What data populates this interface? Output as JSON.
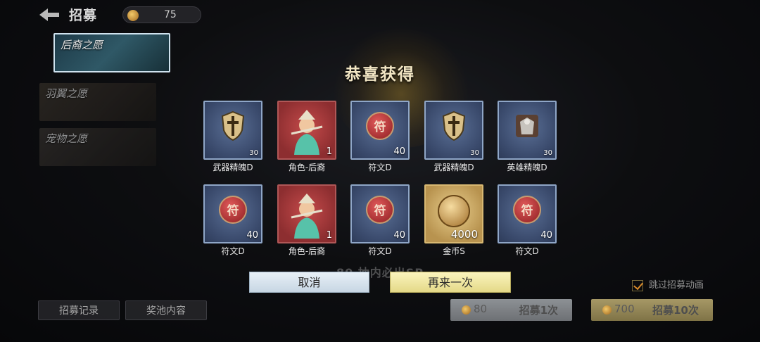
{
  "header": {
    "title": "招募",
    "currency_value": "75"
  },
  "banners": [
    {
      "label": "后裔之愿"
    },
    {
      "label": "羽翼之愿"
    },
    {
      "label": "宠物之愿"
    }
  ],
  "popup": {
    "title": "恭喜获得",
    "rewards": [
      {
        "name": "武器精魄D",
        "qty": "30",
        "frame": "blue",
        "icon": "shield-cross-icon"
      },
      {
        "name": "角色-后裔",
        "qty": "1",
        "frame": "red",
        "icon": "archer-portrait-icon"
      },
      {
        "name": "符文D",
        "qty": "40",
        "frame": "blue",
        "icon": "rune-icon",
        "icon_char": "符"
      },
      {
        "name": "武器精魄D",
        "qty": "30",
        "frame": "blue",
        "icon": "shield-cross-icon"
      },
      {
        "name": "英雄精魄D",
        "qty": "30",
        "frame": "blue",
        "icon": "armor-icon"
      },
      {
        "name": "符文D",
        "qty": "40",
        "frame": "blue",
        "icon": "rune-icon",
        "icon_char": "符"
      },
      {
        "name": "角色-后裔",
        "qty": "1",
        "frame": "red",
        "icon": "archer-portrait-icon"
      },
      {
        "name": "符文D",
        "qty": "40",
        "frame": "blue",
        "icon": "rune-icon",
        "icon_char": "符"
      },
      {
        "name": "金币S",
        "qty": "4000",
        "frame": "gold",
        "icon": "gold-coin-icon"
      },
      {
        "name": "符文D",
        "qty": "40",
        "frame": "blue",
        "icon": "rune-icon",
        "icon_char": "符"
      }
    ],
    "cancel_label": "取消",
    "again_label": "再来一次"
  },
  "pity_text": "80 抽内必出SP",
  "skip_animation_label": "跳过招募动画",
  "buttons": {
    "history": "招募记录",
    "pool": "奖池内容",
    "draw1_cost": "80",
    "draw1_label": "招募1次",
    "draw10_cost": "700",
    "draw10_label": "招募10次"
  },
  "colors": {
    "blue_frame": "#8fa6c7",
    "red_frame": "#b05757",
    "gold_frame": "#d8b872",
    "title": "#f2e6c4"
  }
}
